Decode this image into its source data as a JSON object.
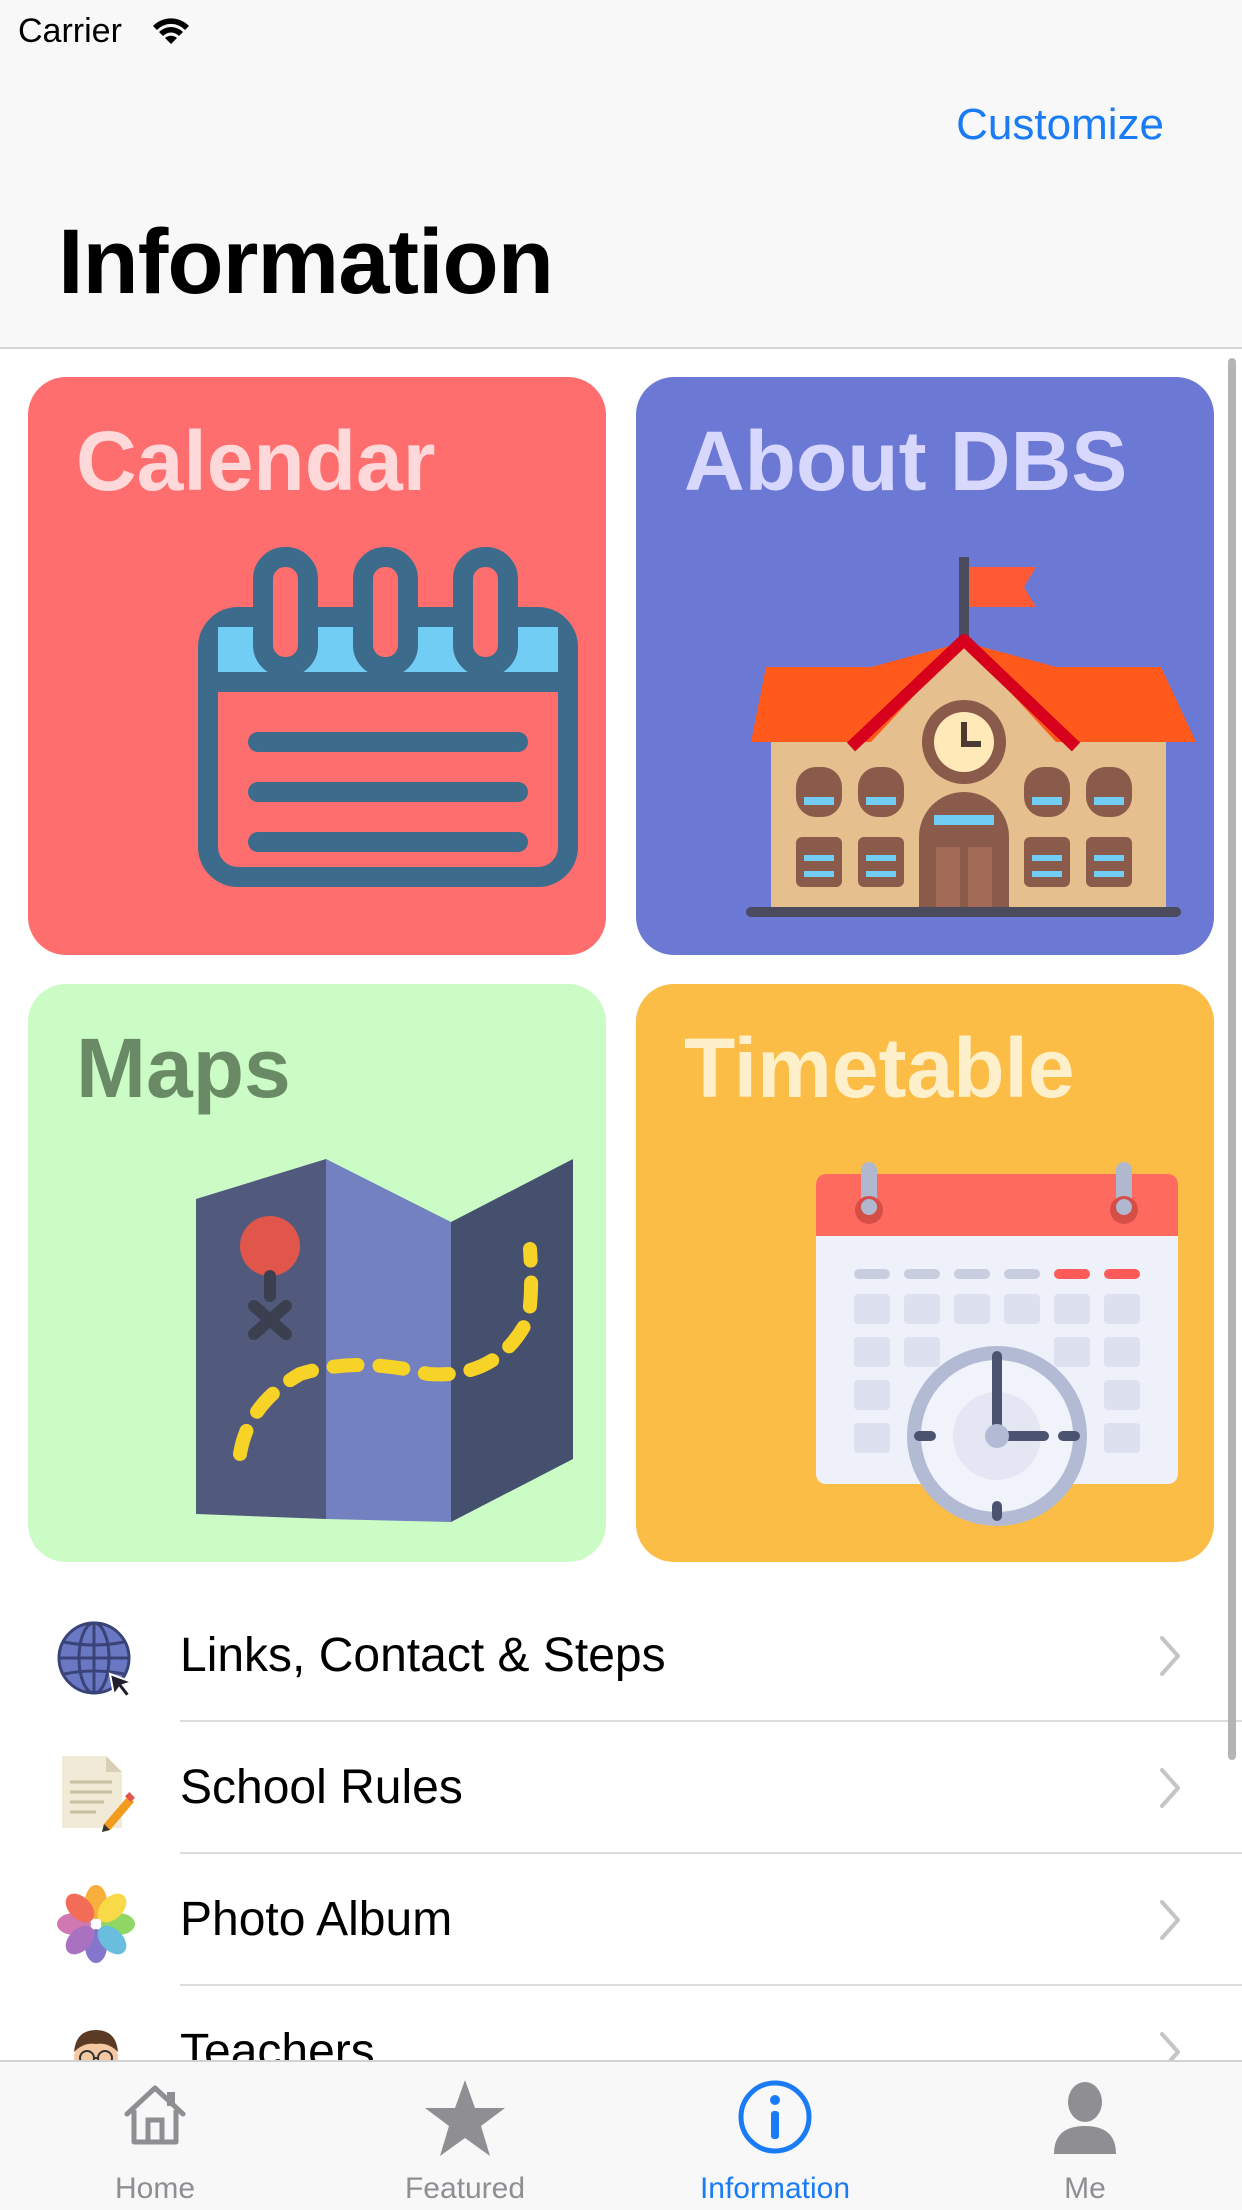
{
  "status_bar": {
    "carrier": "Carrier"
  },
  "nav": {
    "customize_label": "Customize",
    "title": "Information"
  },
  "tiles": [
    {
      "label": "Calendar",
      "color": "#ff6e6e",
      "label_color": "#ffd9d9",
      "icon": "calendar-icon"
    },
    {
      "label": "About DBS",
      "color": "#6b78d4",
      "label_color": "#d8d8ff",
      "icon": "school-building-icon"
    },
    {
      "label": "Maps",
      "color": "#cbfcc6",
      "label_color": "#6a8a66",
      "icon": "folded-map-icon"
    },
    {
      "label": "Timetable",
      "color": "#fbbd45",
      "label_color": "#fff0cc",
      "icon": "timetable-clock-icon"
    }
  ],
  "list": [
    {
      "label": "Links, Contact & Steps",
      "icon": "globe-cursor-icon"
    },
    {
      "label": "School Rules",
      "icon": "document-pencil-icon"
    },
    {
      "label": "Photo Album",
      "icon": "photos-flower-icon"
    },
    {
      "label": "Teachers",
      "icon": "teacher-avatar-icon"
    }
  ],
  "tab_bar": {
    "items": [
      {
        "label": "Home",
        "icon": "house-icon",
        "active": false
      },
      {
        "label": "Featured",
        "icon": "star-icon",
        "active": false
      },
      {
        "label": "Information",
        "icon": "info-circle-icon",
        "active": true
      },
      {
        "label": "Me",
        "icon": "person-icon",
        "active": false
      }
    ],
    "active_color": "#1a7cf5",
    "inactive_color": "#8e8e93"
  }
}
